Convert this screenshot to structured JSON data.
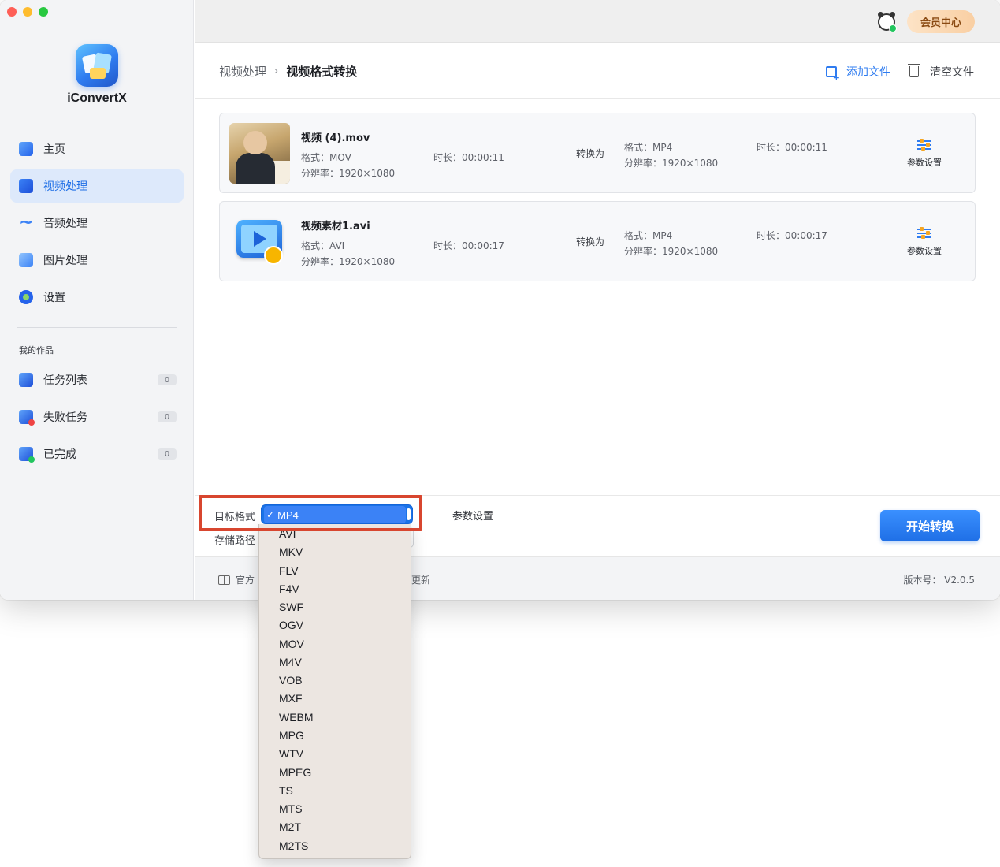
{
  "app": {
    "name": "iConvertX"
  },
  "sidebar": {
    "nav": [
      {
        "label": "主页",
        "icon": "home-icon"
      },
      {
        "label": "视频处理",
        "icon": "video-icon",
        "active": true
      },
      {
        "label": "音频处理",
        "icon": "audio-wave-icon"
      },
      {
        "label": "图片处理",
        "icon": "image-icon"
      },
      {
        "label": "设置",
        "icon": "gear-icon"
      }
    ],
    "section_title": "我的作品",
    "works": [
      {
        "label": "任务列表",
        "count": "0",
        "icon": "task-list-icon"
      },
      {
        "label": "失败任务",
        "count": "0",
        "icon": "failed-task-icon"
      },
      {
        "label": "已完成",
        "count": "0",
        "icon": "completed-icon"
      }
    ]
  },
  "topbar": {
    "vip_label": "会员中心",
    "avatar_icon": "panda-avatar-icon"
  },
  "header": {
    "breadcrumb_parent": "视频处理",
    "breadcrumb_sep": "›",
    "breadcrumb_current": "视频格式转换",
    "add_file_label": "添加文件",
    "clear_file_label": "清空文件"
  },
  "files": [
    {
      "name": "视频 (4).mov",
      "format": "格式：MOV",
      "resolution": "分辨率：1920×1080",
      "duration": "时长：00:00:11",
      "convert_to": "转换为",
      "out_format": "格式：MP4",
      "out_resolution": "分辨率：1920×1080",
      "out_duration": "时长：00:00:11",
      "param_label": "参数设置"
    },
    {
      "name": "视频素材1.avi",
      "format": "格式：AVI",
      "resolution": "分辨率：1920×1080",
      "duration": "时长：00:00:17",
      "convert_to": "转换为",
      "out_format": "格式：MP4",
      "out_resolution": "分辨率：1920×1080",
      "out_duration": "时长：00:00:17",
      "param_label": "参数设置"
    }
  ],
  "bottom": {
    "target_format_label": "目标格式",
    "storage_path_label": "存储路径",
    "param_label": "参数设置",
    "start_label": "开始转换"
  },
  "format_dropdown": {
    "selected": "MP4",
    "check": "✓",
    "options": [
      "AVI",
      "MKV",
      "FLV",
      "F4V",
      "SWF",
      "OGV",
      "MOV",
      "M4V",
      "VOB",
      "MXF",
      "WEBM",
      "MPG",
      "WTV",
      "MPEG",
      "TS",
      "MTS",
      "M2T",
      "M2TS"
    ]
  },
  "footer": {
    "left_label": "官方",
    "update_label": "更新",
    "version": "版本号： V2.0.5"
  },
  "colors": {
    "accent": "#2f7cf0",
    "highlight": "#d8462f",
    "vip": "#f9cfa3"
  }
}
